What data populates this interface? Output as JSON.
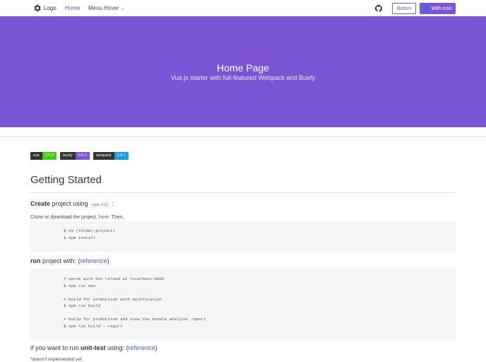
{
  "nav": {
    "logo": "Logo",
    "home": "Home",
    "menu": "Menu Hover",
    "button": "Button",
    "with_icon": "With Icon"
  },
  "hero": {
    "title": "Home Page",
    "subtitle": "Vue.js starter with full-featured Webpack and Buefy"
  },
  "badges": [
    {
      "k": "vue",
      "v": "2.5.2",
      "color": "#4c1"
    },
    {
      "k": "buefy",
      "v": "0.6.1",
      "color": "#7b55d6"
    },
    {
      "k": "webpack",
      "v": "3.8.1",
      "color": "#1c9be6"
    }
  ],
  "content": {
    "heading": "Getting Started",
    "create_bold": "Create",
    "create_rest": " project using ",
    "create_code": "vue-cli",
    "create_colon": " :",
    "clone_pre": "Clone or download the project, ",
    "clone_link": "here",
    "clone_post": ". Then,",
    "code1": "$ cd (folder-project)\n$ npm install",
    "run_bold": "run",
    "run_rest": " project with: (",
    "run_link": "reference",
    "run_close": ")",
    "code2": "# serve with hot reload at localhost:8080\n$ npm run dev\n\n# build for production with minification\n$ npm run build\n\n# build for production and view the bundle analyzer report\n$ npm run build --report",
    "unit_pre": "if you want to run ",
    "unit_bold": "unit-test",
    "unit_mid": " using: (",
    "unit_link": "reference",
    "unit_close": ")",
    "note": "*doesn't implemented yet"
  }
}
